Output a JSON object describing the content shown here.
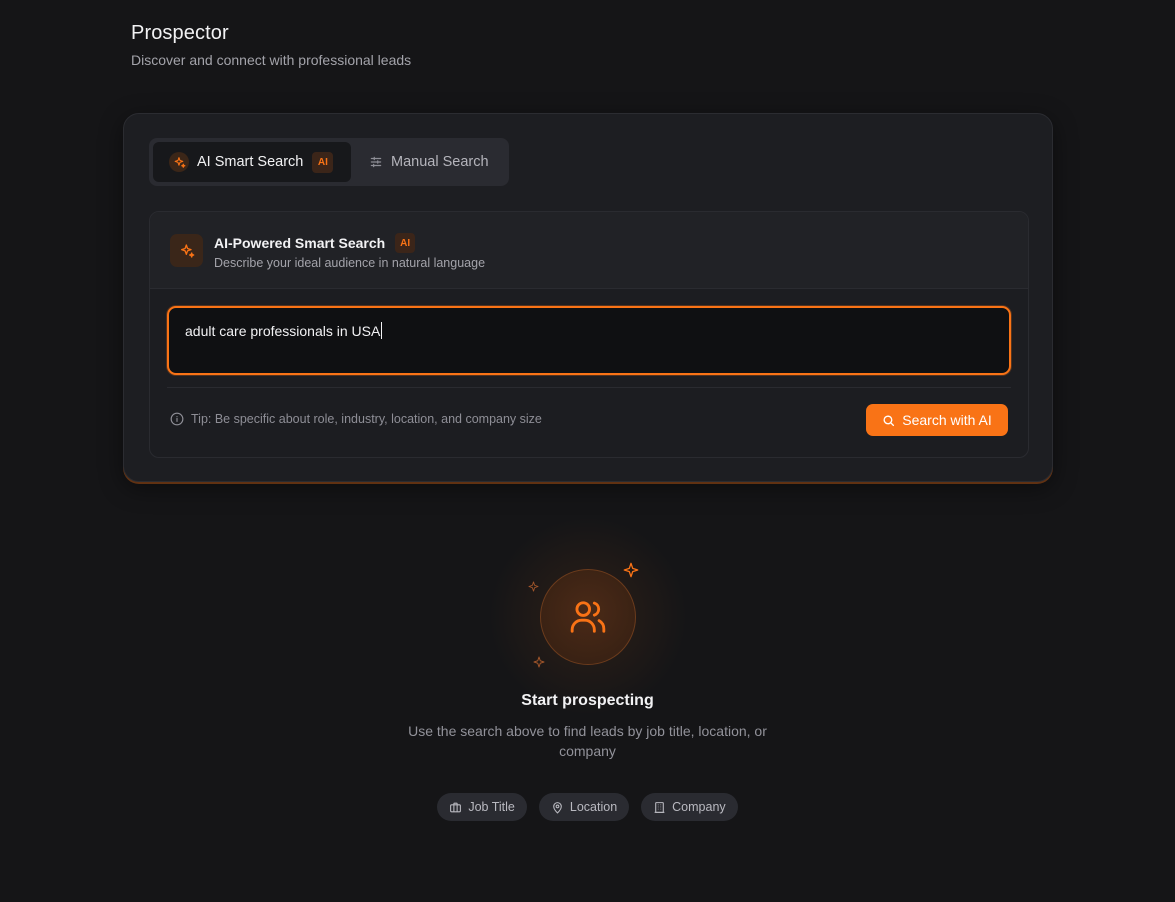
{
  "header": {
    "title": "Prospector",
    "subtitle": "Discover and connect with professional leads"
  },
  "tabs": [
    {
      "label": "AI Smart Search",
      "badge": "AI",
      "active": true,
      "icon": "sparkles-icon"
    },
    {
      "label": "Manual Search",
      "active": false,
      "icon": "sliders-icon"
    }
  ],
  "smart_search": {
    "title": "AI-Powered Smart Search",
    "badge": "AI",
    "description": "Describe your ideal audience in natural language",
    "query": "adult care professionals in USA",
    "tip": "Tip: Be specific about role, industry, location, and company size",
    "button_label": "Search with AI"
  },
  "empty_state": {
    "title": "Start prospecting",
    "description": "Use the search above to find leads by job title, location, or company",
    "icon": "users-icon"
  },
  "chips": [
    {
      "label": "Job Title",
      "icon": "briefcase-icon"
    },
    {
      "label": "Location",
      "icon": "map-pin-icon"
    },
    {
      "label": "Company",
      "icon": "building-icon"
    }
  ],
  "colors": {
    "accent": "#f97316",
    "background": "#151517",
    "card": "#1d1e22"
  }
}
